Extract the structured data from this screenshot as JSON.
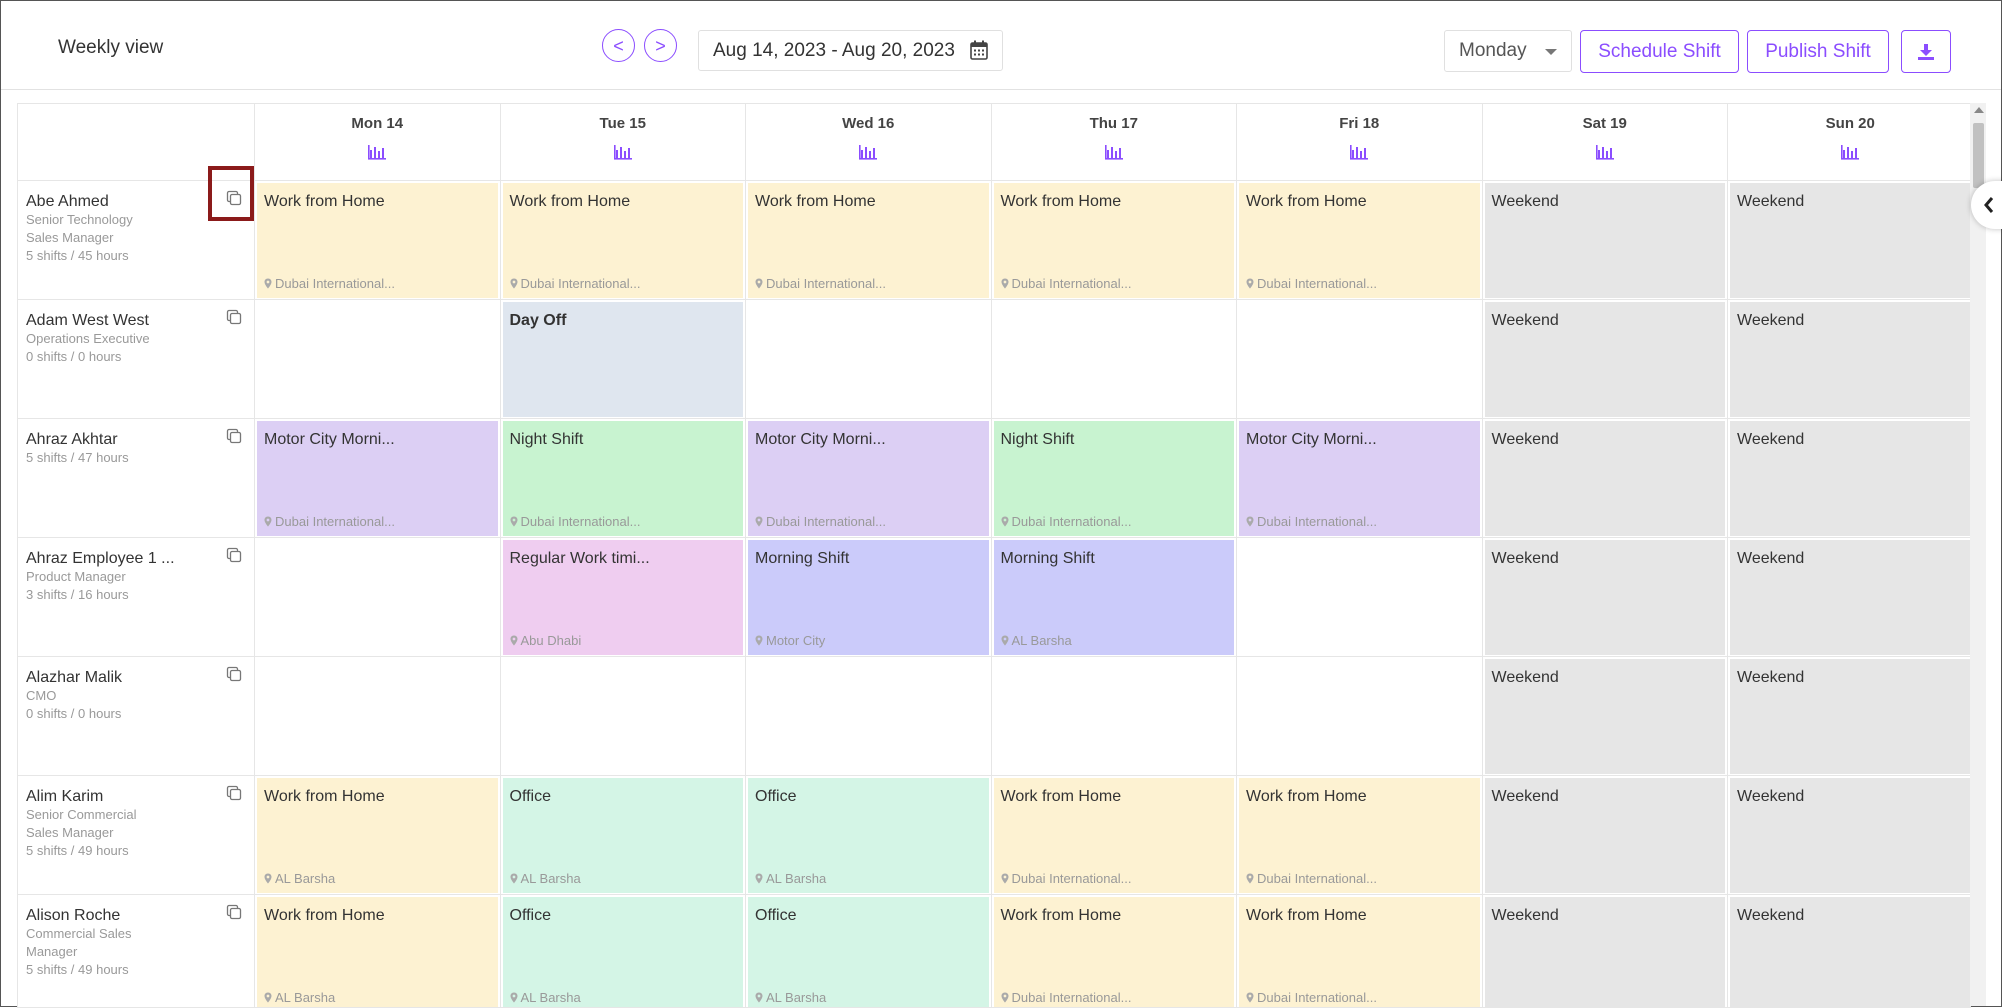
{
  "header": {
    "title": "Weekly view",
    "prev_label": "<",
    "next_label": ">",
    "date_range": "Aug 14, 2023 - Aug 20, 2023",
    "week_start_select": "Monday",
    "schedule_shift_label": "Schedule Shift",
    "publish_shift_label": "Publish Shift",
    "download_icon": "download-icon"
  },
  "colors": {
    "accent": "#8b4dff",
    "work_from_home": "#fdf2d2",
    "weekend": "#e6e6e6",
    "day_off": "#dfe6ef",
    "motor_city_morning": "#dccff4",
    "night_shift": "#c8f3d0",
    "regular_work": "#efcdf0",
    "morning_shift": "#cbcbfa",
    "office": "#d4f5e6",
    "highlight_box": "#8b1a1a"
  },
  "days": [
    {
      "label": "Mon 14"
    },
    {
      "label": "Tue 15"
    },
    {
      "label": "Wed 16"
    },
    {
      "label": "Thu 17"
    },
    {
      "label": "Fri 18"
    },
    {
      "label": "Sat 19"
    },
    {
      "label": "Sun 20"
    }
  ],
  "employees": [
    {
      "name": "Abe Ahmed",
      "role": "Senior Technology Sales Manager",
      "stats": "5 shifts / 45 hours",
      "shifts": [
        {
          "title": "Work from Home",
          "location": "Dubai International...",
          "type": "wfh"
        },
        {
          "title": "Work from Home",
          "location": "Dubai International...",
          "type": "wfh"
        },
        {
          "title": "Work from Home",
          "location": "Dubai International...",
          "type": "wfh"
        },
        {
          "title": "Work from Home",
          "location": "Dubai International...",
          "type": "wfh"
        },
        {
          "title": "Work from Home",
          "location": "Dubai International...",
          "type": "wfh"
        },
        {
          "title": "Weekend",
          "location": "",
          "type": "weekend"
        },
        {
          "title": "Weekend",
          "location": "",
          "type": "weekend"
        }
      ]
    },
    {
      "name": "Adam West West",
      "role": "Operations Executive",
      "stats": "0 shifts / 0 hours",
      "shifts": [
        null,
        {
          "title": "Day Off",
          "location": "",
          "type": "dayoff"
        },
        null,
        null,
        null,
        {
          "title": "Weekend",
          "location": "",
          "type": "weekend"
        },
        {
          "title": "Weekend",
          "location": "",
          "type": "weekend"
        }
      ]
    },
    {
      "name": "Ahraz Akhtar",
      "role": "",
      "stats": "5 shifts / 47 hours",
      "shifts": [
        {
          "title": "Motor City Morni...",
          "location": "Dubai International...",
          "type": "motor"
        },
        {
          "title": "Night Shift",
          "location": "Dubai International...",
          "type": "night"
        },
        {
          "title": "Motor City Morni...",
          "location": "Dubai International...",
          "type": "motor"
        },
        {
          "title": "Night Shift",
          "location": "Dubai International...",
          "type": "night"
        },
        {
          "title": "Motor City Morni...",
          "location": "Dubai International...",
          "type": "motor"
        },
        {
          "title": "Weekend",
          "location": "",
          "type": "weekend"
        },
        {
          "title": "Weekend",
          "location": "",
          "type": "weekend"
        }
      ]
    },
    {
      "name": "Ahraz Employee 1 ...",
      "role": "Product Manager",
      "stats": "3 shifts / 16 hours",
      "shifts": [
        null,
        {
          "title": "Regular Work timi...",
          "location": "Abu Dhabi",
          "type": "regular"
        },
        {
          "title": "Morning Shift",
          "location": "Motor City",
          "type": "morning"
        },
        {
          "title": "Morning Shift",
          "location": "AL Barsha",
          "type": "morning"
        },
        null,
        {
          "title": "Weekend",
          "location": "",
          "type": "weekend"
        },
        {
          "title": "Weekend",
          "location": "",
          "type": "weekend"
        }
      ]
    },
    {
      "name": "Alazhar Malik",
      "role": "CMO",
      "stats": "0 shifts / 0 hours",
      "shifts": [
        null,
        null,
        null,
        null,
        null,
        {
          "title": "Weekend",
          "location": "",
          "type": "weekend"
        },
        {
          "title": "Weekend",
          "location": "",
          "type": "weekend"
        }
      ]
    },
    {
      "name": "Alim Karim",
      "role": "Senior Commercial Sales Manager",
      "stats": "5 shifts / 49 hours",
      "shifts": [
        {
          "title": "Work from Home",
          "location": "AL Barsha",
          "type": "wfh"
        },
        {
          "title": "Office",
          "location": "AL Barsha",
          "type": "office"
        },
        {
          "title": "Office",
          "location": "AL Barsha",
          "type": "office"
        },
        {
          "title": "Work from Home",
          "location": "Dubai International...",
          "type": "wfh"
        },
        {
          "title": "Work from Home",
          "location": "Dubai International...",
          "type": "wfh"
        },
        {
          "title": "Weekend",
          "location": "",
          "type": "weekend"
        },
        {
          "title": "Weekend",
          "location": "",
          "type": "weekend"
        }
      ]
    },
    {
      "name": "Alison Roche",
      "role": "Commercial Sales Manager",
      "stats": "5 shifts / 49 hours",
      "shifts": [
        {
          "title": "Work from Home",
          "location": "AL Barsha",
          "type": "wfh"
        },
        {
          "title": "Office",
          "location": "AL Barsha",
          "type": "office"
        },
        {
          "title": "Office",
          "location": "AL Barsha",
          "type": "office"
        },
        {
          "title": "Work from Home",
          "location": "Dubai International...",
          "type": "wfh"
        },
        {
          "title": "Work from Home",
          "location": "Dubai International...",
          "type": "wfh"
        },
        {
          "title": "Weekend",
          "location": "",
          "type": "weekend"
        },
        {
          "title": "Weekend",
          "location": "",
          "type": "weekend"
        }
      ]
    }
  ]
}
